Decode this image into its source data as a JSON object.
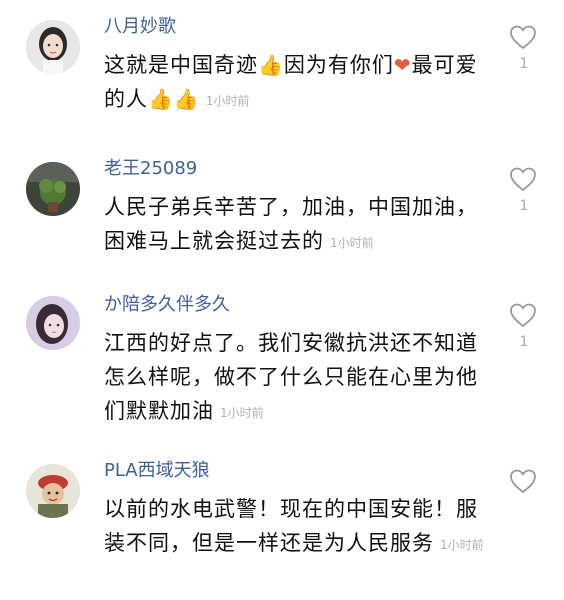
{
  "comments": [
    {
      "name": "八月妙歌",
      "parts": [
        "这就是中国奇迹",
        "因为有你们",
        "最可爱的人"
      ],
      "time": "1小时前",
      "likes": "1"
    },
    {
      "name": "老王25089",
      "text": "人民子弟兵辛苦了，加油，中国加油，困难马上就会挺过去的",
      "time": "1小时前",
      "likes": "1"
    },
    {
      "name": "か陪多久伴多久",
      "text": "江西的好点了。我们安徽抗洪还不知道怎么样呢，做不了什么只能在心里为他们默默加油",
      "time": "1小时前",
      "likes": "1"
    },
    {
      "name": "PLA西域天狼",
      "text": "以前的水电武警！现在的中国安能！服装不同，但是一样还是为人民服务",
      "time": "1小时前",
      "likes": ""
    }
  ],
  "icons": {
    "like": "heart-outline-icon",
    "thumb": "thumbs-up-emoji",
    "heart": "red-heart-emoji"
  },
  "colors": {
    "username": "#3f5f9c",
    "time": "#b0b0b0",
    "like_icon": "#999999"
  }
}
